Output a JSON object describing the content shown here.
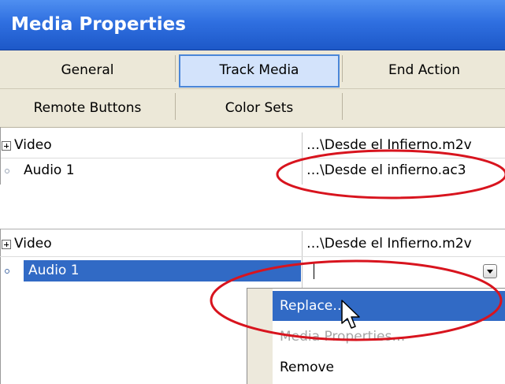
{
  "window": {
    "title": "Media Properties"
  },
  "tabs": [
    {
      "label": "General"
    },
    {
      "label": "Track Media"
    },
    {
      "label": "End Action"
    },
    {
      "label": "Remote Buttons"
    },
    {
      "label": "Color Sets"
    }
  ],
  "properties": [
    {
      "name": "Video",
      "value": "…\\Desde el Infierno.m2v"
    },
    {
      "name": "Audio 1",
      "value": "…\\Desde el infierno.ac3"
    }
  ],
  "lower": {
    "rows": [
      {
        "name": "Video",
        "value": "…\\Desde el Infierno.m2v"
      },
      {
        "name": "Audio 1",
        "value": ""
      }
    ]
  },
  "menu": {
    "items": [
      {
        "label": "Replace…",
        "state": "highlighted"
      },
      {
        "label": "Media Properties…",
        "state": "disabled"
      },
      {
        "label": "Remove",
        "state": "enabled"
      }
    ]
  },
  "annotations": {
    "circle_color": "#d8141e"
  },
  "colors": {
    "title_bar": "#2f6fe0",
    "selection": "#316ac5",
    "tab_background": "#ece8d8"
  }
}
